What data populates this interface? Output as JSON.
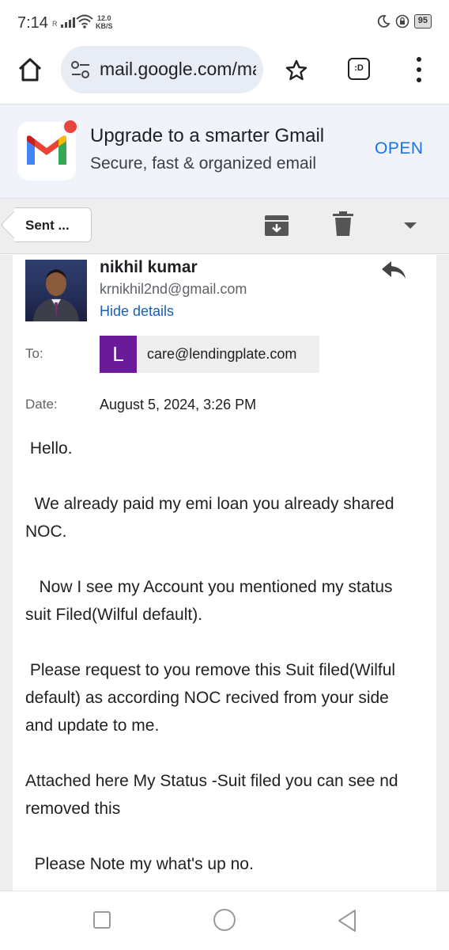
{
  "status_bar": {
    "time": "7:14",
    "signal_label": "R",
    "net_speed_value": "12.0",
    "net_speed_unit": "KB/S",
    "battery": "95"
  },
  "browser": {
    "url": "mail.google.com/mail",
    "icons": [
      "home-icon",
      "site-settings-icon",
      "star-icon",
      "tab-switcher-icon",
      "more-vert-icon"
    ],
    "tab_label": ":D"
  },
  "banner": {
    "title": "Upgrade to a smarter Gmail",
    "subtitle": "Secure, fast & organized email",
    "action_label": "OPEN"
  },
  "toolbar": {
    "back_label": "Sent ...",
    "icons": [
      "archive-icon",
      "trash-icon",
      "dropdown-icon"
    ]
  },
  "email": {
    "sender_name": "nikhil kumar",
    "sender_email": "krnikhil2nd@gmail.com",
    "hide_details_label": "Hide details",
    "to_label": "To:",
    "recipient_initial": "L",
    "recipient_email": "care@lendingplate.com",
    "recipient_color": "#6a1b9a",
    "date_label": "Date:",
    "date_value": "August 5, 2024, 3:26 PM",
    "body_lines": [
      " Hello.",
      "  We already paid my emi loan you already shared",
      "NOC.",
      "   Now I see my Account you mentioned my status",
      "suit Filed(Wilful default).",
      " Please request to you remove this Suit filed(Wilful",
      "default) as according NOC recived from your side",
      "and update to me.",
      "Attached here My Status -Suit filed you can see nd",
      "removed this",
      "  Please Note my what's up no."
    ]
  },
  "colors": {
    "accent": "#1a73e8",
    "link": "#1a5fb4",
    "gmail_red": "#ea4335",
    "gmail_blue": "#4285f4",
    "gmail_green": "#34a853",
    "gmail_yellow": "#fbbc04"
  }
}
